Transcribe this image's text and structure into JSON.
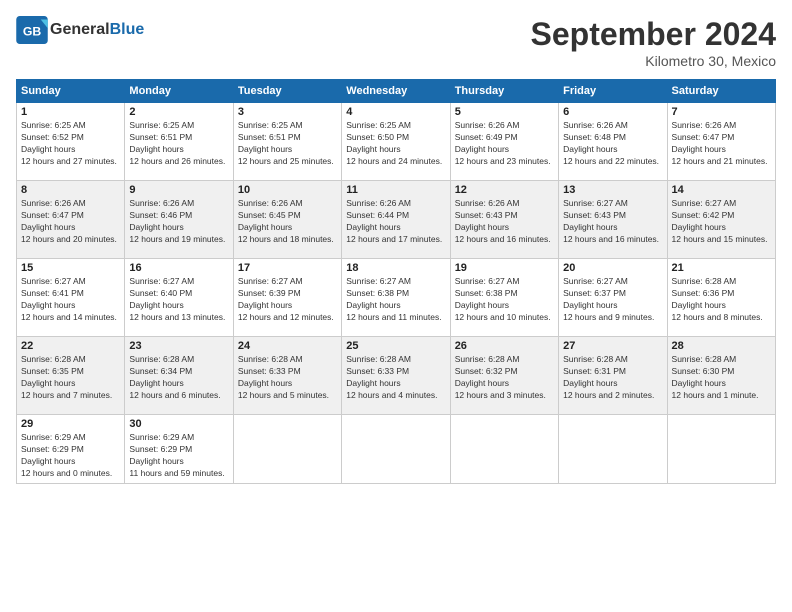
{
  "header": {
    "logo_line1": "General",
    "logo_line2": "Blue",
    "title": "September 2024",
    "subtitle": "Kilometro 30, Mexico"
  },
  "weekdays": [
    "Sunday",
    "Monday",
    "Tuesday",
    "Wednesday",
    "Thursday",
    "Friday",
    "Saturday"
  ],
  "weeks": [
    [
      {
        "day": "1",
        "sunrise": "6:25 AM",
        "sunset": "6:52 PM",
        "daylight": "12 hours and 27 minutes."
      },
      {
        "day": "2",
        "sunrise": "6:25 AM",
        "sunset": "6:51 PM",
        "daylight": "12 hours and 26 minutes."
      },
      {
        "day": "3",
        "sunrise": "6:25 AM",
        "sunset": "6:51 PM",
        "daylight": "12 hours and 25 minutes."
      },
      {
        "day": "4",
        "sunrise": "6:25 AM",
        "sunset": "6:50 PM",
        "daylight": "12 hours and 24 minutes."
      },
      {
        "day": "5",
        "sunrise": "6:26 AM",
        "sunset": "6:49 PM",
        "daylight": "12 hours and 23 minutes."
      },
      {
        "day": "6",
        "sunrise": "6:26 AM",
        "sunset": "6:48 PM",
        "daylight": "12 hours and 22 minutes."
      },
      {
        "day": "7",
        "sunrise": "6:26 AM",
        "sunset": "6:47 PM",
        "daylight": "12 hours and 21 minutes."
      }
    ],
    [
      {
        "day": "8",
        "sunrise": "6:26 AM",
        "sunset": "6:47 PM",
        "daylight": "12 hours and 20 minutes."
      },
      {
        "day": "9",
        "sunrise": "6:26 AM",
        "sunset": "6:46 PM",
        "daylight": "12 hours and 19 minutes."
      },
      {
        "day": "10",
        "sunrise": "6:26 AM",
        "sunset": "6:45 PM",
        "daylight": "12 hours and 18 minutes."
      },
      {
        "day": "11",
        "sunrise": "6:26 AM",
        "sunset": "6:44 PM",
        "daylight": "12 hours and 17 minutes."
      },
      {
        "day": "12",
        "sunrise": "6:26 AM",
        "sunset": "6:43 PM",
        "daylight": "12 hours and 16 minutes."
      },
      {
        "day": "13",
        "sunrise": "6:27 AM",
        "sunset": "6:43 PM",
        "daylight": "12 hours and 16 minutes."
      },
      {
        "day": "14",
        "sunrise": "6:27 AM",
        "sunset": "6:42 PM",
        "daylight": "12 hours and 15 minutes."
      }
    ],
    [
      {
        "day": "15",
        "sunrise": "6:27 AM",
        "sunset": "6:41 PM",
        "daylight": "12 hours and 14 minutes."
      },
      {
        "day": "16",
        "sunrise": "6:27 AM",
        "sunset": "6:40 PM",
        "daylight": "12 hours and 13 minutes."
      },
      {
        "day": "17",
        "sunrise": "6:27 AM",
        "sunset": "6:39 PM",
        "daylight": "12 hours and 12 minutes."
      },
      {
        "day": "18",
        "sunrise": "6:27 AM",
        "sunset": "6:38 PM",
        "daylight": "12 hours and 11 minutes."
      },
      {
        "day": "19",
        "sunrise": "6:27 AM",
        "sunset": "6:38 PM",
        "daylight": "12 hours and 10 minutes."
      },
      {
        "day": "20",
        "sunrise": "6:27 AM",
        "sunset": "6:37 PM",
        "daylight": "12 hours and 9 minutes."
      },
      {
        "day": "21",
        "sunrise": "6:28 AM",
        "sunset": "6:36 PM",
        "daylight": "12 hours and 8 minutes."
      }
    ],
    [
      {
        "day": "22",
        "sunrise": "6:28 AM",
        "sunset": "6:35 PM",
        "daylight": "12 hours and 7 minutes."
      },
      {
        "day": "23",
        "sunrise": "6:28 AM",
        "sunset": "6:34 PM",
        "daylight": "12 hours and 6 minutes."
      },
      {
        "day": "24",
        "sunrise": "6:28 AM",
        "sunset": "6:33 PM",
        "daylight": "12 hours and 5 minutes."
      },
      {
        "day": "25",
        "sunrise": "6:28 AM",
        "sunset": "6:33 PM",
        "daylight": "12 hours and 4 minutes."
      },
      {
        "day": "26",
        "sunrise": "6:28 AM",
        "sunset": "6:32 PM",
        "daylight": "12 hours and 3 minutes."
      },
      {
        "day": "27",
        "sunrise": "6:28 AM",
        "sunset": "6:31 PM",
        "daylight": "12 hours and 2 minutes."
      },
      {
        "day": "28",
        "sunrise": "6:28 AM",
        "sunset": "6:30 PM",
        "daylight": "12 hours and 1 minute."
      }
    ],
    [
      {
        "day": "29",
        "sunrise": "6:29 AM",
        "sunset": "6:29 PM",
        "daylight": "12 hours and 0 minutes."
      },
      {
        "day": "30",
        "sunrise": "6:29 AM",
        "sunset": "6:29 PM",
        "daylight": "11 hours and 59 minutes."
      },
      null,
      null,
      null,
      null,
      null
    ]
  ]
}
